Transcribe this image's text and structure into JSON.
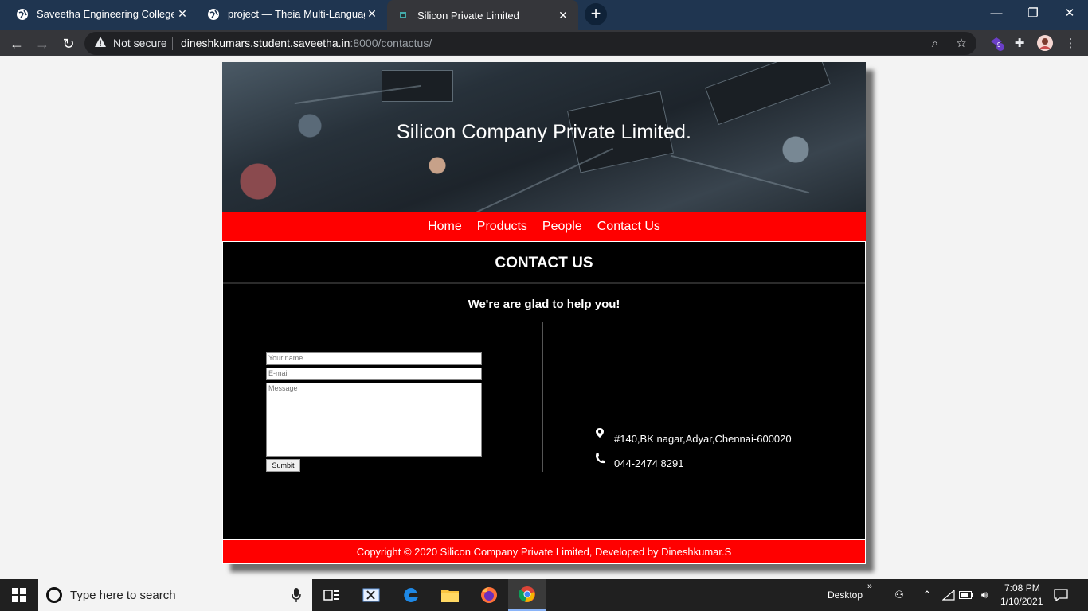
{
  "browser": {
    "tabs": [
      {
        "title": "Saveetha Engineering College",
        "active": false
      },
      {
        "title": "project — Theia Multi-Language",
        "active": false
      },
      {
        "title": "Silicon Private Limited",
        "active": true
      }
    ],
    "new_tab_label": "+",
    "security_text": "Not secure",
    "url_host": "dineshkumars.student.saveetha.in",
    "url_path": ":8000/contactus/",
    "extension_badge": "9"
  },
  "site": {
    "banner_title": "Silicon Company Private Limited.",
    "nav": [
      "Home",
      "Products",
      "People",
      "Contact Us"
    ],
    "heading": "CONTACT US",
    "subheading": "We're are glad to help you!",
    "form": {
      "name_placeholder": "Your name",
      "email_placeholder": "E-mail",
      "message_placeholder": "Message",
      "submit_label": "Sumbit"
    },
    "address": "#140,BK nagar,Adyar,Chennai-600020",
    "phone": "044-2474 8291",
    "footer": "Copyright © 2020 Silicon Company Private Limited, Developed by Dineshkumar.S",
    "colors": {
      "accent": "#ff0000",
      "content_bg": "#000000"
    }
  },
  "taskbar": {
    "search_placeholder": "Type here to search",
    "desktop_label": "Desktop",
    "time": "7:08 PM",
    "date": "1/10/2021"
  }
}
